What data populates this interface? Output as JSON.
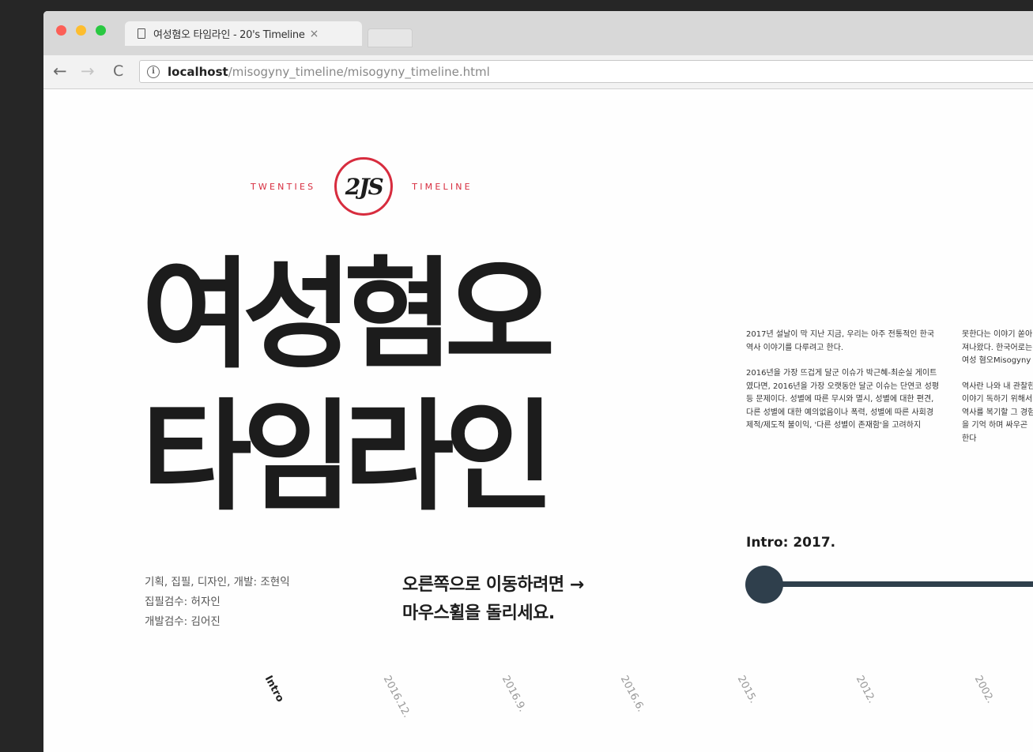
{
  "browser": {
    "tab_title": "여성혐오 타임라인 - 20's Timeline",
    "tab_close": "×",
    "url_host": "localhost",
    "url_path": "/misogyny_timeline/misogyny_timeline.html"
  },
  "nav": {
    "back": "←",
    "forward": "→",
    "reload": "C",
    "info": "i"
  },
  "brand": {
    "left": "TWENTIES",
    "logo": "2JS",
    "right": "TIMELINE",
    "accent": "#d72c3e"
  },
  "hero": {
    "line1": "여성혐오",
    "line2": "타임라인"
  },
  "credits": {
    "line1": "기획, 집필, 디자인, 개발: 조현익",
    "line2": "집필검수: 허자인",
    "line3": "개발검수: 김어진"
  },
  "hint": {
    "line1": "오른쪽으로 이동하려면 →",
    "line2": "마우스휠을 돌리세요."
  },
  "intro": {
    "col1_p1": "2017년 설날이 막 지난 지금, 우리는 아주 전통적인 한국 역사 이야기를 다루려고 한다.",
    "col1_p2": "2016년을 가장 뜨겁게 달군 이슈가 박근혜-최순실 게이트였다면, 2016년을 가장 오랫동안 달군 이슈는 단연코 성평등 문제이다. 성별에 따른 무시와 멸시, 성별에 대한 편견, 다른 성별에 대한 예의없음이나 폭력, 성별에 따른 사회경제적/제도적 불이익, '다른 성별이 존재함'을 고려하지",
    "col2_p1": "못한다는 이야기 쏟아져나왔다. 한국어로는 여성 혐오Misogyny",
    "col2_p2": "역사란 나와 내 관찰한 이야기 독하기 위해서 역사를 복기할 그 경험을 기억 하며 싸우곤 한다",
    "label": "Intro: 2017."
  },
  "timeline_ticks": [
    "Intro",
    "2016.12.",
    "2016.9.",
    "2016.6.",
    "2015.",
    "2012.",
    "2002."
  ]
}
